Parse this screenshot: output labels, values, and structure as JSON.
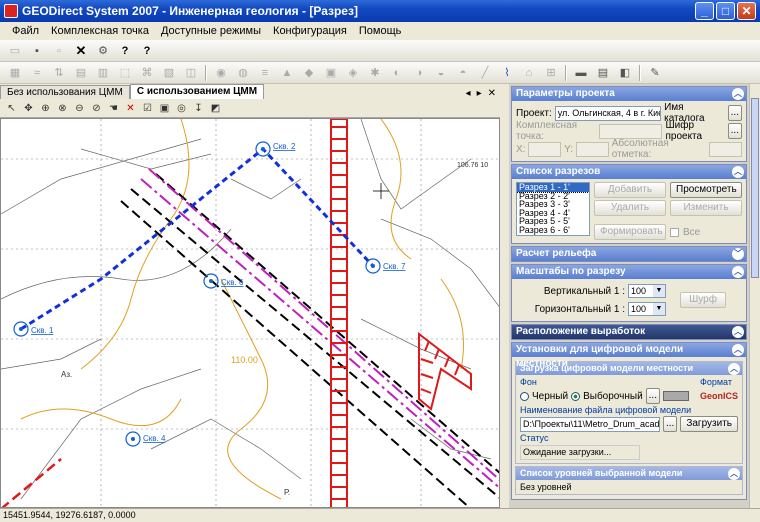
{
  "window": {
    "title": "GEODirect System 2007 - Инженерная геология - [Разрез]"
  },
  "menu": [
    "Файл",
    "Комплексная точка",
    "Доступные режимы",
    "Конфигурация",
    "Помощь"
  ],
  "tabs": {
    "tab1": "Без использования ЦММ",
    "tab2": "С использованием ЦММ"
  },
  "map": {
    "labels": {
      "skv1": "Скв. 1",
      "skv2": "Скв. 2",
      "skv7": "Скв. 7",
      "skv6": "Скв. 6",
      "skv4": "Скв. 4",
      "contour": "110.00",
      "elev1": "106.76 10",
      "letter_a": "Аз.",
      "letter_r": "Р."
    }
  },
  "params": {
    "header": "Параметры проекта",
    "project_label": "Проект:",
    "project_value": "ул. Ольгинская, 4 в г. Киеве",
    "catalog_label": "Имя каталога",
    "complex_point_label": "Комплексная точка:",
    "code_label": "Шифр проекта",
    "x_label": "X:",
    "y_label": "Y:",
    "abs_label": "Абсолютная отметка:",
    "dots": "..."
  },
  "sections": {
    "header": "Список разрезов",
    "items": [
      "Разрез 1 - 1'",
      "Разрез 2 - 2'",
      "Разрез 3 - 3'",
      "Разрез 4 - 4'",
      "Разрез 5 - 5'",
      "Разрез 6 - 6'"
    ],
    "add": "Добавить",
    "view": "Просмотреть",
    "delete": "Удалить",
    "edit": "Изменить",
    "form": "Формировать",
    "all": "Все"
  },
  "relief": {
    "header": "Расчет рельефа"
  },
  "scales": {
    "header": "Масштабы по разрезу",
    "vertical_label": "Вертикальный 1 :",
    "vertical_value": "100",
    "horizontal_label": "Горизонтальный 1 :",
    "horizontal_value": "100",
    "shurf": "Шурф"
  },
  "workings": {
    "header": "Расположение выработок"
  },
  "dtm": {
    "header": "Установки для цифровой модели местности",
    "load_header": "Загрузка цифровой модели местности",
    "bg_label": "Фон",
    "black": "Черный",
    "selective": "Выборочный",
    "format_label": "Формат",
    "format_value": "GeonICS",
    "file_label": "Наименование файла цифровой модели",
    "file_value": "D:\\Проекты\\11\\Metro_Drum_acad.dwg",
    "load_btn": "Загрузить",
    "status_label": "Статус",
    "status_value": "Ожидание загрузки..."
  },
  "levels": {
    "header": "Список уровней выбранной модели",
    "item": "Без уровней"
  },
  "statusbar": {
    "coords": "15451.9544, 19276.6187, 0.0000"
  },
  "colors": {
    "accent": "#0a3ab0",
    "section_blue": "#5a7fd0",
    "tunnel_red": "#e01818",
    "path_blue": "#1030e0"
  }
}
